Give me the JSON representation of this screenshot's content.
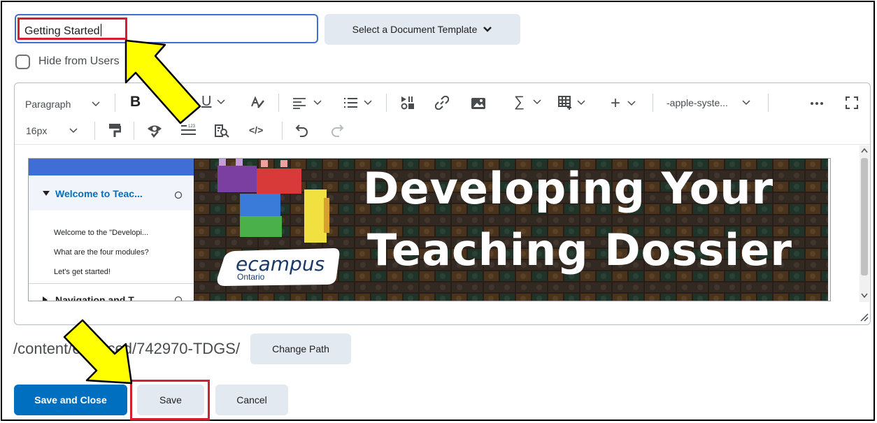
{
  "form": {
    "title_value": "Getting Started",
    "template_button_label": "Select a Document Template",
    "hide_from_users_label": "Hide from Users"
  },
  "toolbar": {
    "paragraph_label": "Paragraph",
    "font_family_label": "-apple-syste...",
    "font_size_label": "16px",
    "bold_label": "B",
    "underline_label": "U",
    "sigma_label": "∑",
    "code_label": "</>"
  },
  "content": {
    "nav": {
      "section_open": "Welcome to Teac...",
      "items": [
        "Welcome to the \"Developi...",
        "What are the four modules?",
        "Let's get started!"
      ],
      "section_closed": "Navigation and T..."
    },
    "banner": {
      "line1": "Developing Your",
      "line2": "Teaching Dossier",
      "logo_main": "ecampus",
      "logo_sub": "Ontario"
    }
  },
  "path": {
    "text": "/content/enforced/742970-TDGS/",
    "change_label": "Change Path"
  },
  "actions": {
    "save_close_label": "Save and Close",
    "save_label": "Save",
    "cancel_label": "Cancel"
  },
  "colors": {
    "primary": "#006fbf",
    "highlight": "#d32030",
    "arrow": "#ffff00"
  }
}
